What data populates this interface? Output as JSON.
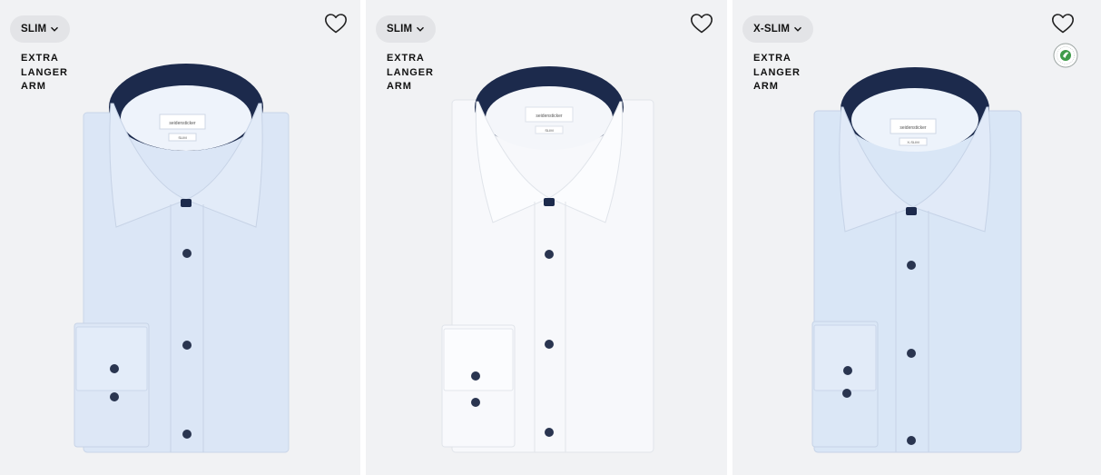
{
  "products": [
    {
      "fit_label": "SLIM",
      "sleeve_lines": [
        "EXTRA",
        "LANGER",
        "ARM"
      ],
      "shirt_color": "#dbe6f6",
      "tag_fit": "SLIM",
      "brand": "seidensticker",
      "eco_badge": false
    },
    {
      "fit_label": "SLIM",
      "sleeve_lines": [
        "EXTRA",
        "LANGER",
        "ARM"
      ],
      "shirt_color": "#f7f8fb",
      "tag_fit": "SLIM",
      "brand": "seidensticker",
      "eco_badge": false
    },
    {
      "fit_label": "X-SLIM",
      "sleeve_lines": [
        "EXTRA",
        "LANGER",
        "ARM"
      ],
      "shirt_color": "#d9e6f6",
      "tag_fit": "X-SLIM",
      "brand": "seidensticker",
      "eco_badge": true
    }
  ],
  "icons": {
    "wishlist": "heart-outline-icon",
    "dropdown": "chevron-down-icon",
    "eco": "sustainability-seal-icon"
  },
  "colors": {
    "card_bg": "#f1f2f4",
    "badge_bg": "#e3e4e7",
    "collar_contrast": "#1c2a4c",
    "button": "#2a3550"
  }
}
